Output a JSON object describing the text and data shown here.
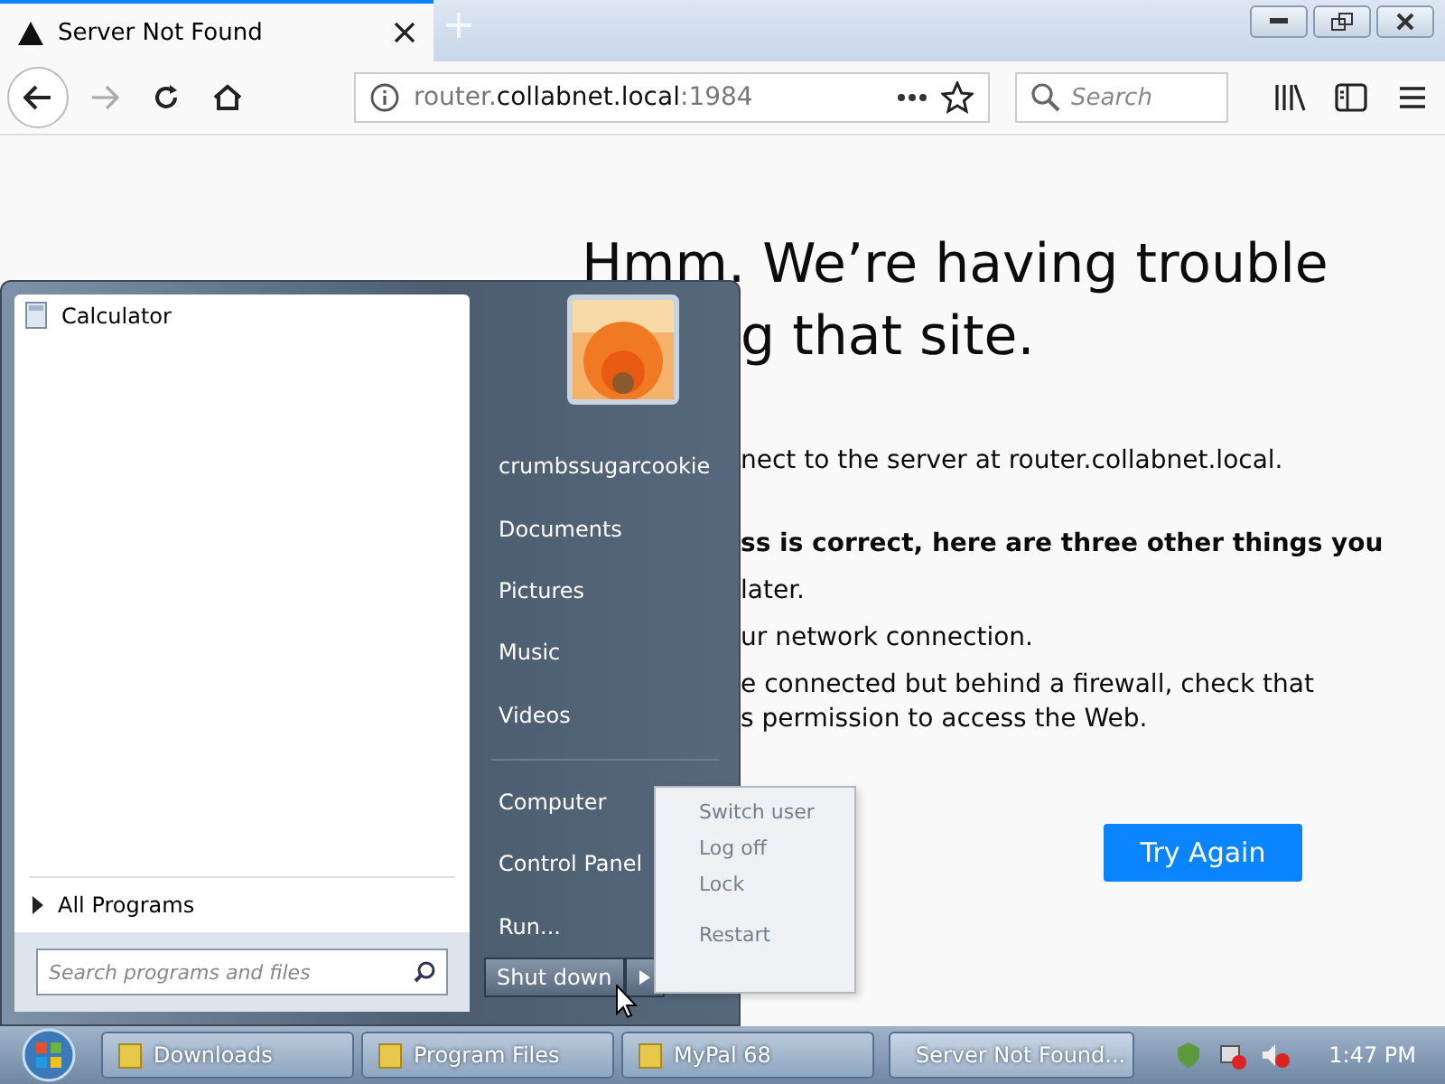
{
  "browser": {
    "tab": {
      "title": "Server Not Found",
      "selected": true
    },
    "address": {
      "host_prefix": "router.",
      "host": "collabnet.local",
      ":port": ":1984"
    },
    "search": {
      "placeholder": "Search"
    }
  },
  "error_page": {
    "heading_line_1": "Hmm. We’re having trouble",
    "heading_line_2": "g that site.",
    "lines": [
      {
        "kind": "text",
        "text": "nect to the server at router.collabnet.local."
      },
      {
        "kind": "bold",
        "text": "ss is correct, here are three other things you"
      },
      {
        "kind": "text",
        "text": "later."
      },
      {
        "kind": "text",
        "text": "ur network connection."
      },
      {
        "kind": "text",
        "text": "e connected but behind a firewall, check that"
      },
      {
        "kind": "tight",
        "text": "s permission to access the Web."
      }
    ],
    "button": "Try Again"
  },
  "start_menu": {
    "programs": [
      {
        "label": "Calculator"
      }
    ],
    "all_programs": "All Programs",
    "search": {
      "placeholder": "Search programs and files"
    },
    "places": [
      {
        "label": "crumbssugarcookie",
        "divider_after": false
      },
      {
        "label": "Documents",
        "divider_after": false
      },
      {
        "label": "Pictures",
        "divider_after": false
      },
      {
        "label": "Music",
        "divider_after": false
      },
      {
        "label": "Videos",
        "divider_after": true
      },
      {
        "label": "Computer",
        "divider_after": false
      },
      {
        "label": "Control Panel",
        "divider_after": false
      },
      {
        "label": "Run...",
        "divider_after": false
      }
    ],
    "shutdown": "Shut down",
    "shutdown_option_groups": [
      [
        {
          "label": "Switch user"
        },
        {
          "label": "Log off"
        },
        {
          "label": "Lock"
        }
      ],
      [
        {
          "label": "Restart"
        }
      ]
    ]
  },
  "taskbar": {
    "buttons": [
      {
        "label": "Downloads",
        "kind": "folder",
        "selected": false
      },
      {
        "label": "Program Files",
        "kind": "folder",
        "selected": false
      },
      {
        "label": "MyPal 68",
        "kind": "folder",
        "selected": false
      },
      {
        "label": "Server Not Found...",
        "kind": "browser",
        "selected": true
      }
    ],
    "clock": "1:47 PM"
  }
}
